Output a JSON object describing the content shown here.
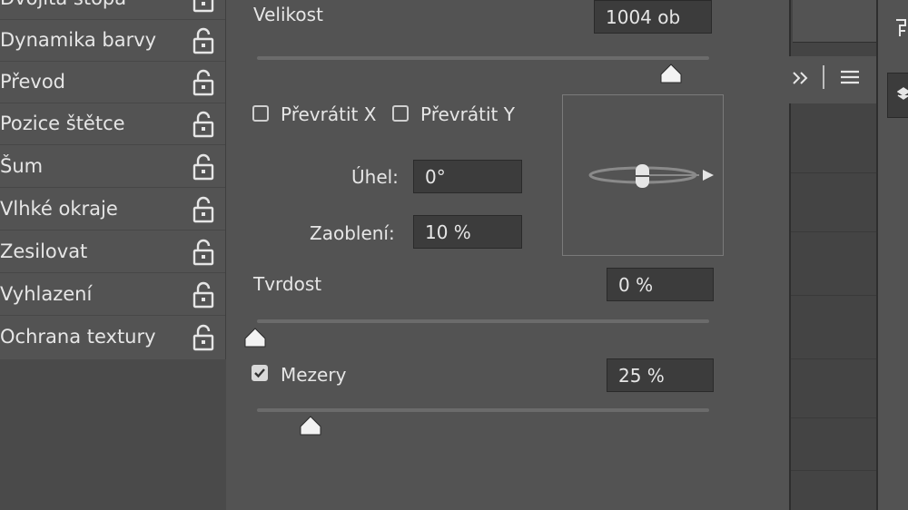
{
  "brush_settings": [
    {
      "label": "Dvojitá stopa"
    },
    {
      "label": "Dynamika barvy"
    },
    {
      "label": "Převod"
    },
    {
      "label": "Pozice štětce"
    },
    {
      "label": "Šum"
    },
    {
      "label": "Vlhké okraje"
    },
    {
      "label": "Zesilovat"
    },
    {
      "label": "Vyhlazení"
    },
    {
      "label": "Ochrana textury"
    }
  ],
  "tip_shape": {
    "size_label": "Velikost",
    "size_value": "1004 ob",
    "flip_x_label": "Převrátit X",
    "flip_x_checked": false,
    "flip_y_label": "Převrátit Y",
    "flip_y_checked": false,
    "angle_label": "Úhel:",
    "angle_value": "0°",
    "roundness_label": "Zaoblení:",
    "roundness_value": "10 %",
    "hardness_label": "Tvrdost",
    "hardness_value": "0 %",
    "spacing_label": "Mezery",
    "spacing_checked": true,
    "spacing_value": "25 %"
  },
  "panel_menu": {
    "expand_icon": "double-chevron-right-icon",
    "menu_icon": "hamburger-menu-icon"
  },
  "colors": {
    "panel_bg": "#535353",
    "field_bg": "#3c3c3c",
    "text": "#e6e6e6"
  }
}
